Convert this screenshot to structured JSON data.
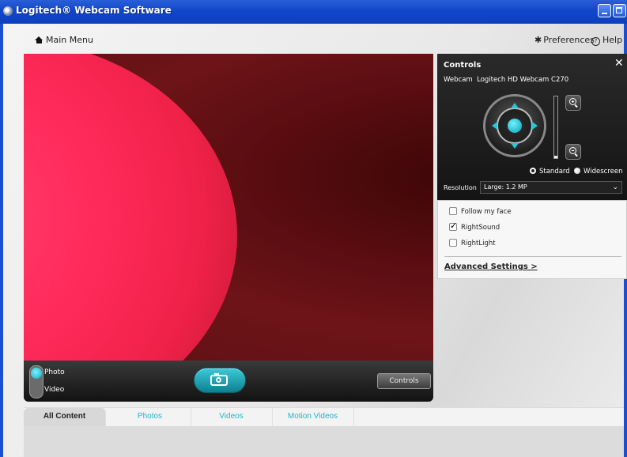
{
  "window": {
    "title": "Logitech® Webcam Software"
  },
  "topbar": {
    "main_menu": "Main Menu",
    "preferences": "Preferences",
    "help": "Help"
  },
  "capture": {
    "photo_label": "Photo",
    "video_label": "Video",
    "mode": "photo",
    "controls_button": "Controls"
  },
  "controls_panel": {
    "title": "Controls",
    "webcam_label": "Webcam",
    "webcam_name": "Logitech HD Webcam C270",
    "zoom_level": 0.04,
    "aspect_options": [
      "Standard",
      "Widescreen"
    ],
    "aspect_selected": "Widescreen",
    "resolution_label": "Resolution",
    "resolution_value": "Large: 1.2 MP",
    "options": [
      {
        "label": "Follow my face",
        "checked": false
      },
      {
        "label": "RightSound",
        "checked": true
      },
      {
        "label": "RightLight",
        "checked": false
      }
    ],
    "advanced_link": "Advanced Settings >"
  },
  "tabs": [
    {
      "label": "All Content",
      "active": true
    },
    {
      "label": "Photos",
      "active": false
    },
    {
      "label": "Videos",
      "active": false
    },
    {
      "label": "Motion Videos",
      "active": false
    }
  ],
  "colors": {
    "title_bar": "#1247c9",
    "accent": "#27b4c6",
    "panel": "#1e1e1e"
  }
}
